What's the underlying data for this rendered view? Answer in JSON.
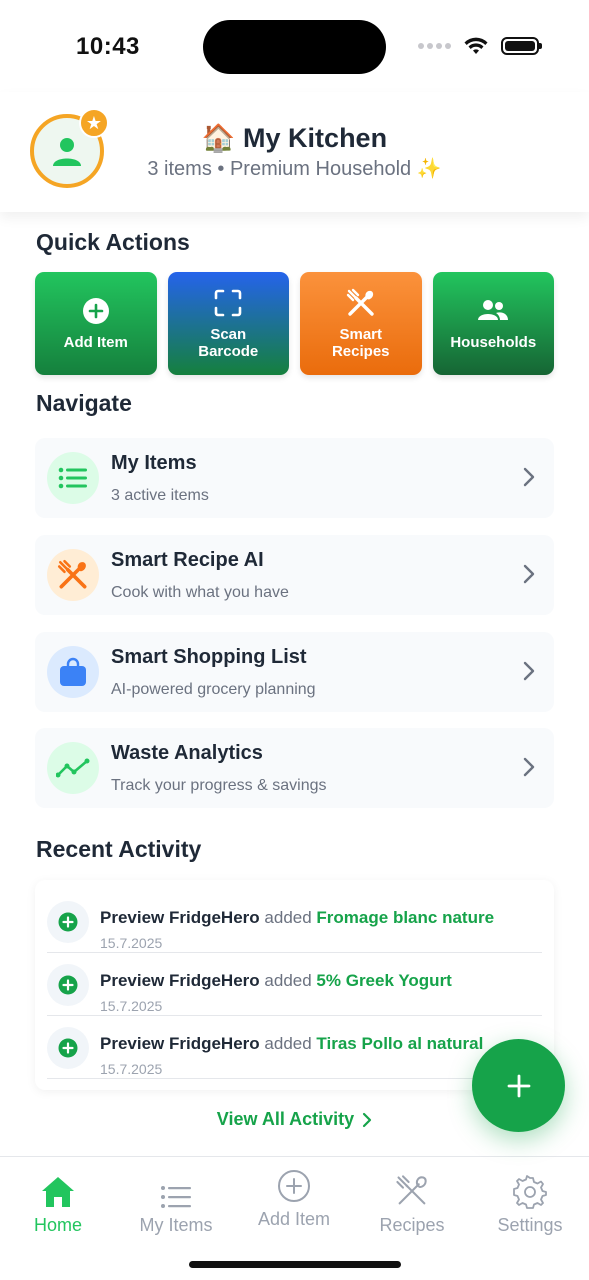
{
  "status_bar": {
    "time": "10:43"
  },
  "header": {
    "title_emoji": "🏠",
    "title": "My Kitchen",
    "subtitle": "3 items • Premium Household ✨"
  },
  "quick_actions": {
    "heading": "Quick Actions",
    "items": [
      {
        "label": "Add Item",
        "icon": "plus-circle-icon",
        "color": "#22c55e"
      },
      {
        "label": "Scan Barcode",
        "icon": "scan-icon",
        "color": "#2563eb"
      },
      {
        "label": "Smart Recipes",
        "icon": "utensils-icon",
        "color": "#f97316"
      },
      {
        "label": "Households",
        "icon": "people-icon",
        "color": "#16a34a"
      }
    ]
  },
  "navigate": {
    "heading": "Navigate",
    "items": [
      {
        "title": "My Items",
        "subtitle": "3 active items",
        "icon": "list-icon"
      },
      {
        "title": "Smart Recipe AI",
        "subtitle": "Cook with what you have",
        "icon": "utensils-icon"
      },
      {
        "title": "Smart Shopping List",
        "subtitle": "AI-powered grocery planning",
        "icon": "shopping-bag-icon"
      },
      {
        "title": "Waste Analytics",
        "subtitle": "Track your progress & savings",
        "icon": "trend-icon"
      }
    ]
  },
  "recent_activity": {
    "heading": "Recent Activity",
    "items": [
      {
        "user": "Preview FridgeHero",
        "action": "added",
        "item": "Fromage blanc nature",
        "date": "15.7.2025"
      },
      {
        "user": "Preview FridgeHero",
        "action": "added",
        "item": "5% Greek Yogurt",
        "date": "15.7.2025"
      },
      {
        "user": "Preview FridgeHero",
        "action": "added",
        "item": "Tiras Pollo al natural",
        "date": "15.7.2025"
      }
    ],
    "view_all": "View All Activity"
  },
  "tab_bar": {
    "tabs": [
      {
        "label": "Home",
        "active": true
      },
      {
        "label": "My Items",
        "active": false
      },
      {
        "label": "Add Item",
        "active": false
      },
      {
        "label": "Recipes",
        "active": false
      },
      {
        "label": "Settings",
        "active": false
      }
    ]
  },
  "colors": {
    "accent": "#22c55e",
    "accent_dark": "#16a34a",
    "premium": "#f5a524"
  }
}
